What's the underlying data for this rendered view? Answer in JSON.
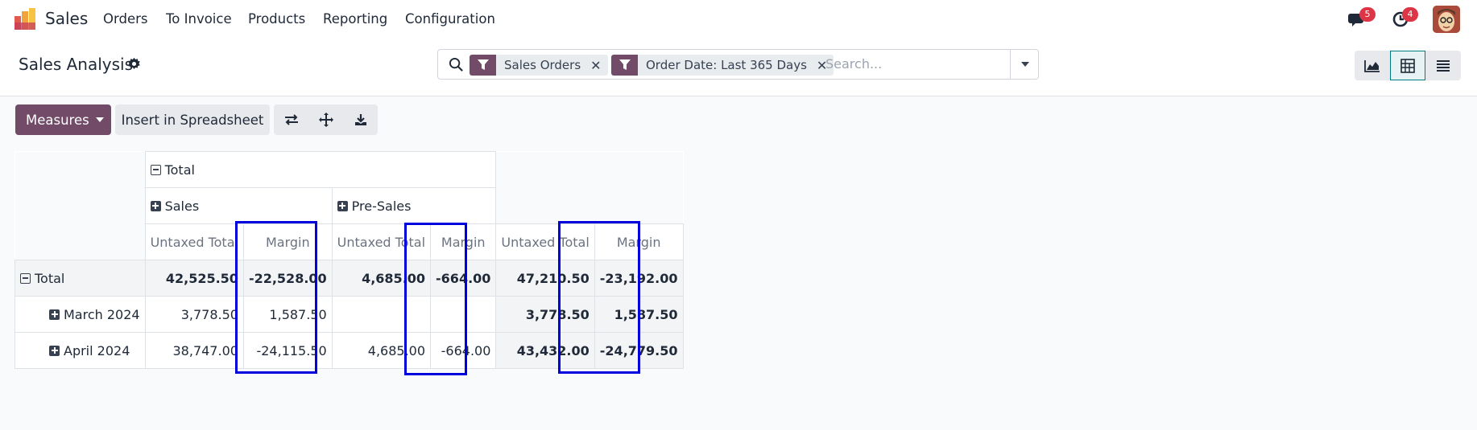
{
  "navbar": {
    "app_name": "Sales",
    "menu": [
      "Orders",
      "To Invoice",
      "Products",
      "Reporting",
      "Configuration"
    ],
    "messages_count": "5",
    "activities_count": "4"
  },
  "control_panel": {
    "title": "Sales Analysis",
    "facets": [
      {
        "label": "Sales Orders"
      },
      {
        "label": "Order Date: Last 365 Days"
      }
    ],
    "search_placeholder": "Search..."
  },
  "actions": {
    "measures_label": "Measures",
    "insert_label": "Insert in Spreadsheet"
  },
  "pivot": {
    "col_total_label": "Total",
    "col_groups": [
      "Sales",
      "Pre-Sales"
    ],
    "measures": [
      "Untaxed Total",
      "Margin"
    ],
    "rows": [
      {
        "label": "Total",
        "sales_untaxed": "42,525.50",
        "sales_margin": "-22,528.00",
        "pre_untaxed": "4,685.00",
        "pre_margin": "-664.00",
        "tot_untaxed": "47,210.50",
        "tot_margin": "-23,192.00"
      },
      {
        "label": "March 2024",
        "sales_untaxed": "3,778.50",
        "sales_margin": "1,587.50",
        "pre_untaxed": "",
        "pre_margin": "",
        "tot_untaxed": "3,778.50",
        "tot_margin": "1,587.50"
      },
      {
        "label": "April 2024",
        "sales_untaxed": "38,747.00",
        "sales_margin": "-24,115.50",
        "pre_untaxed": "4,685.00",
        "pre_margin": "-664.00",
        "tot_untaxed": "43,432.00",
        "tot_margin": "-24,779.50"
      }
    ]
  },
  "colors": {
    "brand": "#714b67",
    "highlight": "#0000dd",
    "badge": "#dc3545"
  }
}
